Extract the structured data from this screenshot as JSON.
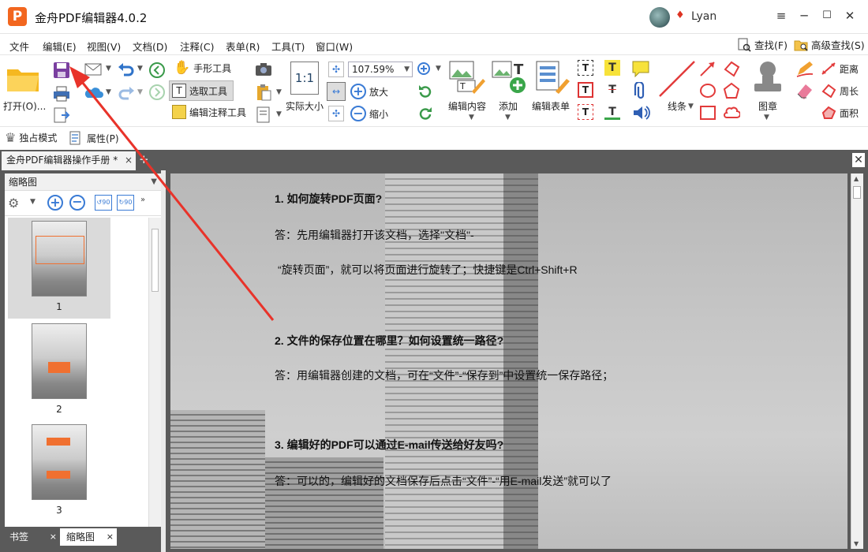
{
  "window": {
    "title": "金舟PDF编辑器4.0.2",
    "logo_letter": "P",
    "user": "Lyan"
  },
  "window_controls": {
    "menu": "≡",
    "minimize": "─",
    "maximize": "☐",
    "close": "✕"
  },
  "menu": {
    "items": [
      "文件",
      "编辑(E)",
      "视图(V)",
      "文档(D)",
      "注释(C)",
      "表单(R)",
      "工具(T)",
      "窗口(W)"
    ],
    "find": "查找(F)",
    "advanced_find": "高级查找(S)"
  },
  "ribbon": {
    "open": "打开(O)...",
    "hand_tool": "手形工具",
    "select_tool": "选取工具",
    "edit_annot_tool": "编辑注释工具",
    "actual_size": "实际大小",
    "zoom_value": "107.59%",
    "zoom_in": "放大",
    "zoom_out": "缩小",
    "edit_content": "编辑内容",
    "add": "添加",
    "edit_form": "编辑表单",
    "lines": "线条",
    "stamp": "图章",
    "distance": "距离",
    "perimeter": "周长",
    "area": "面积"
  },
  "subbar": {
    "exclusive_mode": "独占模式",
    "properties": "属性(P)"
  },
  "doc_tab": {
    "label": "金舟PDF编辑器操作手册 *",
    "close": "×",
    "new": "+",
    "close_all": "✕"
  },
  "left_panel": {
    "title": "缩略图",
    "thumbnails": [
      "1",
      "2",
      "3"
    ],
    "bottom_tabs": [
      {
        "label": "书签"
      },
      {
        "label": "缩略图"
      }
    ]
  },
  "document": {
    "lines": [
      {
        "text": "1. 如何旋转PDF页面?",
        "bold": true
      },
      {
        "text": "答：先用编辑器打开该文档，选择\"文档\"-",
        "bold": false
      },
      {
        "text": "“旋转页面”，就可以将页面进行旋转了；快捷键是Ctrl+Shift+R",
        "bold": false
      },
      {
        "text": "2. 文件的保存位置在哪里？如何设置统一路径?",
        "bold": true
      },
      {
        "text": "答：用编辑器创建的文档，可在“文件”-“保存到”中设置统一保存路径；",
        "bold": false
      },
      {
        "text": "3. 编辑好的PDF可以通过E-mail传送给好友吗?",
        "bold": true
      },
      {
        "text": "答：可以的，编辑好的文档保存后点击“文件”-“用E-mail发送”就可以了",
        "bold": false
      }
    ]
  },
  "colors": {
    "accent": "#f2661f",
    "arrow": "#e8332a",
    "dark_bg": "#5a5a5a"
  }
}
